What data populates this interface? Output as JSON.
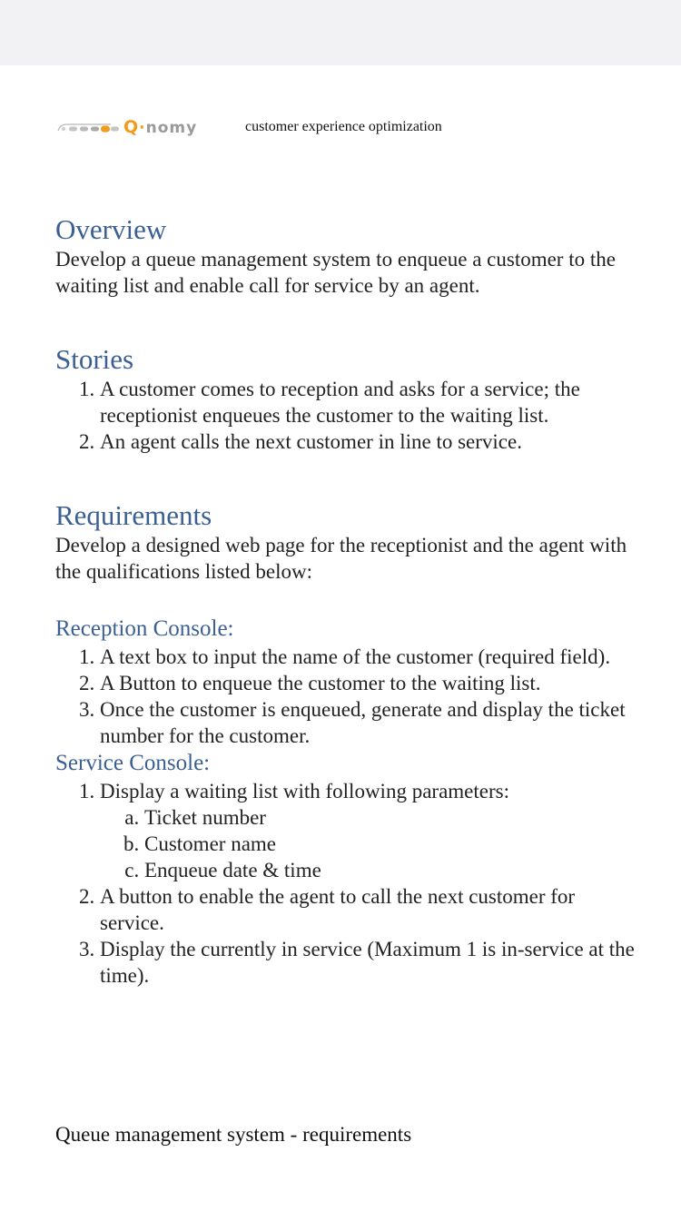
{
  "header": {
    "logo_text": "Q·nomy",
    "tagline": "customer experience optimization"
  },
  "overview": {
    "title": "Overview",
    "text": "Develop a queue management system to enqueue a customer to the waiting list and enable call for service by an agent."
  },
  "stories": {
    "title": "Stories",
    "items": [
      "A customer comes to reception and asks for a service; the receptionist enqueues the customer to the waiting list.",
      "An agent calls the next customer in line to service."
    ]
  },
  "requirements": {
    "title": "Requirements",
    "text": "Develop a designed web page for the receptionist and the agent with the qualifications listed below:",
    "reception": {
      "title": "Reception Console:",
      "items": [
        "A text box to input the name of the customer (required field).",
        "A Button to enqueue the customer to the waiting list.",
        "Once the customer is enqueued, generate and display the ticket number for the customer."
      ]
    },
    "service": {
      "title": "Service Console:",
      "item1": "Display a waiting list with following parameters:",
      "params": [
        "Ticket number",
        "Customer name",
        "Enqueue date & time"
      ],
      "item2": "A button to enable the agent to call the next customer for service.",
      "item3": "Display the currently in service (Maximum 1 is in-service at the time)."
    }
  },
  "footer": {
    "text": "Queue management system - requirements"
  },
  "colors": {
    "heading": "#3b5f93",
    "logo_accent": "#f39a1b",
    "logo_grey": "#9a9a9a",
    "topbar": "#f2f2f4"
  }
}
